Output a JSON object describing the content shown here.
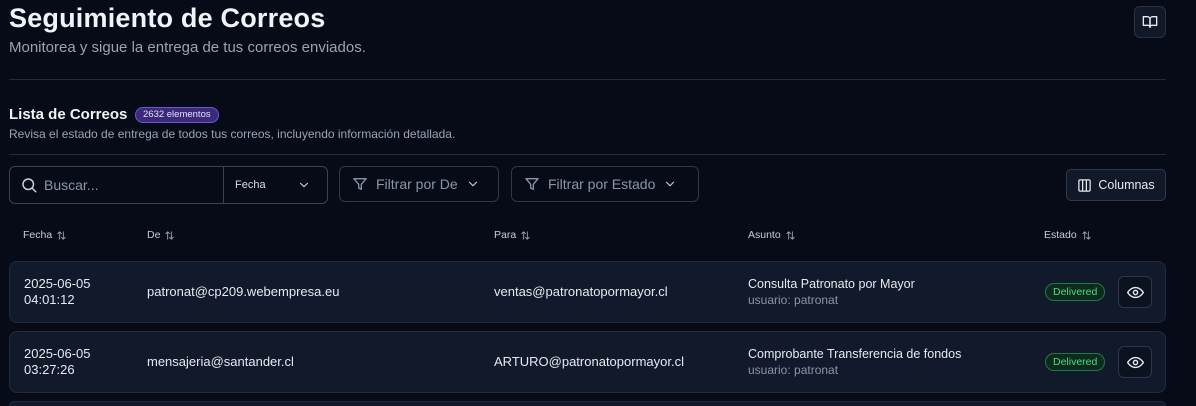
{
  "header": {
    "title": "Seguimiento de Correos",
    "subtitle": "Monitorea y sigue la entrega de tus correos enviados."
  },
  "list": {
    "title": "Lista de Correos",
    "badge": "2632 elementos",
    "subtitle": "Revisa el estado de entrega de todos tus correos, incluyendo información detallada."
  },
  "toolbar": {
    "search_placeholder": "Buscar...",
    "date_select": "Fecha",
    "filter_from": "Filtrar por De",
    "filter_status": "Filtrar por Estado",
    "columns_label": "Columnas"
  },
  "table": {
    "headers": [
      "Fecha",
      "De",
      "Para",
      "Asunto",
      "Estado"
    ],
    "rows": [
      {
        "date": "2025-06-05",
        "time": "04:01:12",
        "from": "patronat@cp209.webempresa.eu",
        "to": "ventas@patronatopormayor.cl",
        "subject": "Consulta Patronato por Mayor",
        "user": "usuario: patronat",
        "status": "Delivered"
      },
      {
        "date": "2025-06-05",
        "time": "03:27:26",
        "from": "mensajeria@santander.cl",
        "to": "ARTURO@patronatopormayor.cl",
        "subject": "Comprobante Transferencia de fondos",
        "user": "usuario: patronat",
        "status": "Delivered"
      }
    ]
  },
  "colors": {
    "background": "#070b17",
    "row_background": "#111a2b",
    "badge_purple": "#3b2a78",
    "status_green": "#4ade80"
  },
  "icons": {
    "docs": "book-open-icon",
    "search": "search-icon",
    "chevron": "chevron-down-icon",
    "filter": "funnel-icon",
    "columns": "columns-icon",
    "sort": "sort-arrows-icon",
    "view": "eye-icon"
  }
}
